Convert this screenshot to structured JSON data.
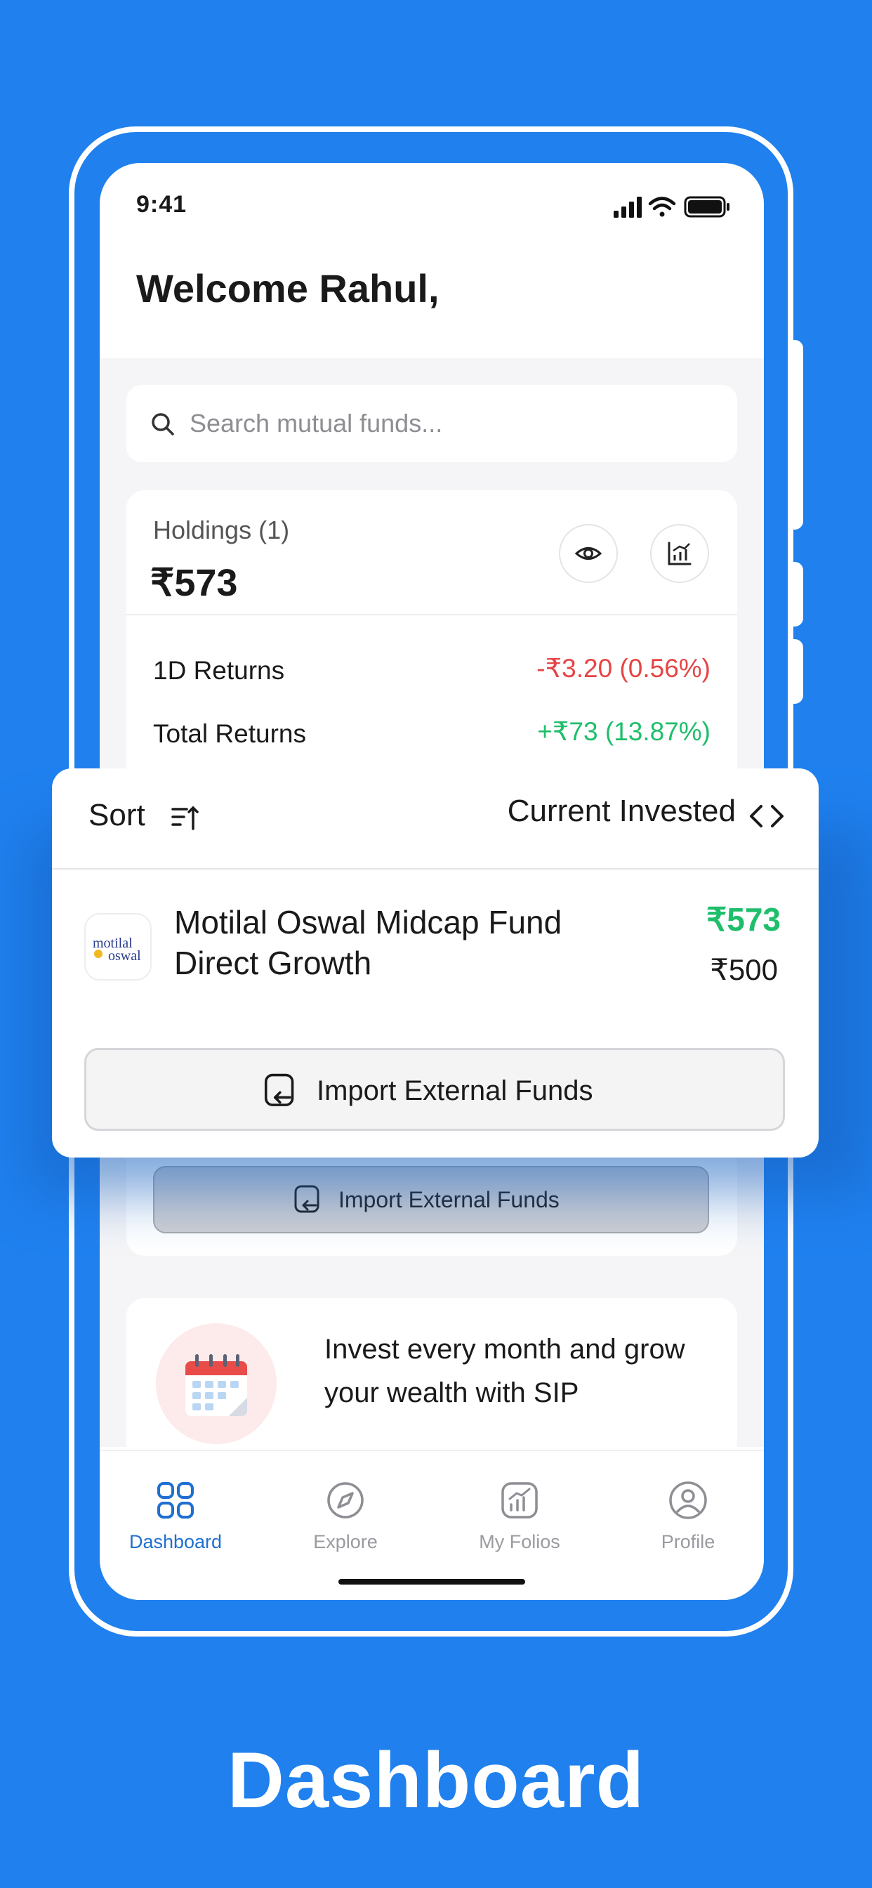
{
  "status_bar": {
    "time": "9:41"
  },
  "header": {
    "welcome": "Welcome Rahul,"
  },
  "search": {
    "placeholder": "Search mutual funds..."
  },
  "holdings": {
    "label": "Holdings (1)",
    "value": "₹573",
    "returns": [
      {
        "label": "1D Returns",
        "value": "-₹3.20 (0.56%)"
      },
      {
        "label": "Total Returns",
        "value": "+₹73 (13.87%)"
      }
    ]
  },
  "list_header": {
    "sort_label": "Sort",
    "view_label": "Current Invested"
  },
  "fund": {
    "logo_line1": "motilal",
    "logo_line2": "oswal",
    "name": "Motilal Oswal Midcap Fund Direct Growth",
    "current": "₹573",
    "invested": "₹500"
  },
  "import_button": {
    "label": "Import External Funds"
  },
  "sip_banner": {
    "text": "Invest every month and grow your wealth with SIP"
  },
  "tabs": [
    {
      "label": "Dashboard",
      "active": true
    },
    {
      "label": "Explore",
      "active": false
    },
    {
      "label": "My Folios",
      "active": false
    },
    {
      "label": "Profile",
      "active": false
    }
  ],
  "footer": {
    "title": "Dashboard"
  },
  "colors": {
    "brand_blue": "#1f80ee",
    "positive": "#1fbe6b",
    "negative": "#e54545",
    "active_tab": "#1f6fd1"
  }
}
